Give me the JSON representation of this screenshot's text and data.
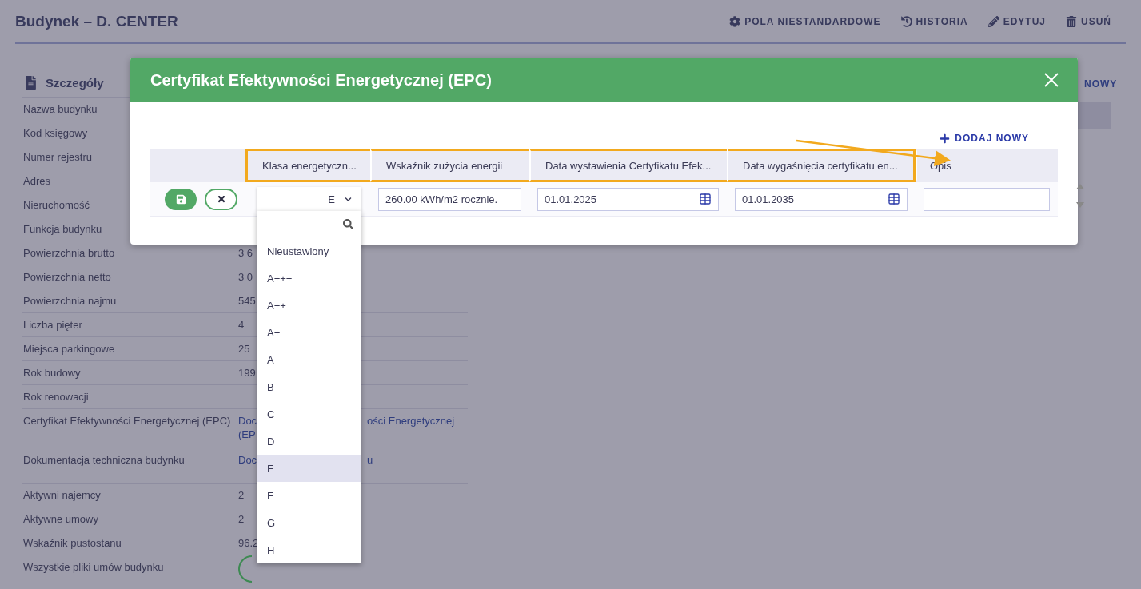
{
  "page": {
    "title": "Budynek – D. CENTER",
    "actions": [
      {
        "kind": "gear",
        "label": "POLA NIESTANDARDOWE"
      },
      {
        "kind": "history",
        "label": "HISTORIA"
      },
      {
        "kind": "pencil",
        "label": "EDYTUJ"
      },
      {
        "kind": "trash",
        "label": "USUŃ"
      }
    ],
    "details": {
      "title": "Szczegóły",
      "rows": [
        {
          "kind": "text",
          "label": "Nazwa budynku"
        },
        {
          "kind": "text",
          "label": "Kod księgowy"
        },
        {
          "kind": "text",
          "label": "Numer rejestru"
        },
        {
          "kind": "text",
          "label": "Adres"
        },
        {
          "kind": "text",
          "label": "Nieruchomość"
        },
        {
          "kind": "text",
          "label": "Funkcja budynku"
        },
        {
          "kind": "text",
          "label": "Powierzchnia brutto",
          "value": "3 6"
        },
        {
          "kind": "text",
          "label": "Powierzchnia netto",
          "value": "3 0"
        },
        {
          "kind": "text",
          "label": "Powierzchnia najmu",
          "value": "545"
        },
        {
          "kind": "text",
          "label": "Liczba pięter",
          "value": "4"
        },
        {
          "kind": "text",
          "label": "Miejsca parkingowe",
          "value": "25"
        },
        {
          "kind": "text",
          "label": "Rok budowy",
          "value": "199"
        },
        {
          "kind": "text",
          "label": "Rok renowacji"
        },
        {
          "kind": "link",
          "label": "Certyfikat Efektywności Energetycznej (EPC)",
          "value": "Doc",
          "value_below": "(EP",
          "value_right": "ości Energetycznej"
        },
        {
          "kind": "link",
          "label": "Dokumentacja techniczna budynku",
          "value": "Doc",
          "value_right": "u"
        },
        {
          "kind": "text",
          "label": "Aktywni najemcy",
          "value": "2"
        },
        {
          "kind": "text",
          "label": "Aktywne umowy",
          "value": "2"
        },
        {
          "kind": "text",
          "label": "Wskaźnik pustostanu",
          "value": "96.2"
        },
        {
          "kind": "toggle",
          "label": "Wszystkie pliki umów budynku"
        }
      ]
    },
    "side_link": "NOWY"
  },
  "modal": {
    "title": "Certyfikat Efektywności Energetycznej (EPC)",
    "add_button": "DODAJ NOWY",
    "columns": [
      {
        "label": "Klasa energetyczn...",
        "highlighted": true
      },
      {
        "label": "Wskaźnik zużycia energii",
        "highlighted": true
      },
      {
        "label": "Data wystawienia Certyfikatu Efek...",
        "highlighted": true
      },
      {
        "label": "Data wygaśnięcia certyfikatu en...",
        "highlighted": true
      },
      {
        "label": "Opis",
        "highlighted": false
      }
    ],
    "row": {
      "cells": [
        {
          "kind": "select",
          "value": "E"
        },
        {
          "kind": "text",
          "value": "260.00 kWh/m2 rocznie."
        },
        {
          "kind": "date",
          "value": "01.01.2025"
        },
        {
          "kind": "date",
          "value": "01.01.2035"
        },
        {
          "kind": "text"
        }
      ]
    },
    "dropdown": {
      "options": [
        {
          "label": "Nieustawiony",
          "selected": false
        },
        {
          "label": "A+++",
          "selected": false
        },
        {
          "label": "A++",
          "selected": false
        },
        {
          "label": "A+",
          "selected": false
        },
        {
          "label": "A",
          "selected": false
        },
        {
          "label": "B",
          "selected": false
        },
        {
          "label": "C",
          "selected": false
        },
        {
          "label": "D",
          "selected": false
        },
        {
          "label": "E",
          "selected": true
        },
        {
          "label": "F",
          "selected": false
        },
        {
          "label": "G",
          "selected": false
        },
        {
          "label": "H",
          "selected": false
        }
      ]
    }
  }
}
